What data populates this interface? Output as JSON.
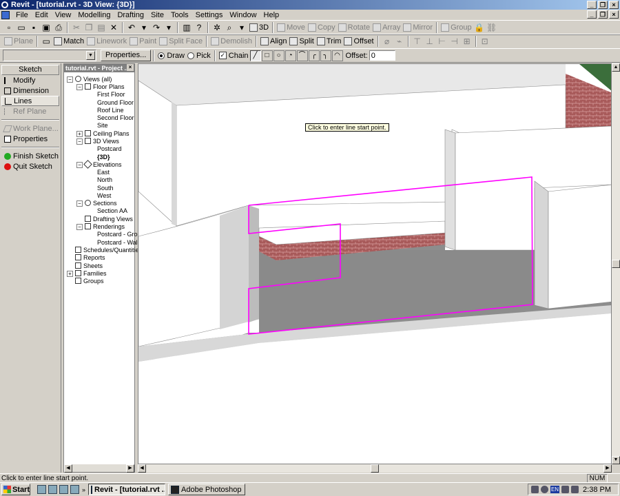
{
  "window": {
    "title": "Revit - [tutorial.rvt - 3D View: {3D}]"
  },
  "menu": [
    "File",
    "Edit",
    "View",
    "Modelling",
    "Drafting",
    "Site",
    "Tools",
    "Settings",
    "Window",
    "Help"
  ],
  "toolbar1": {
    "view3d_label": "3D",
    "move": "Move",
    "copy": "Copy",
    "rotate": "Rotate",
    "array": "Array",
    "mirror": "Mirror",
    "group": "Group"
  },
  "toolbar2": {
    "plane": "Plane",
    "match": "Match",
    "linework": "Linework",
    "paint": "Paint",
    "split_face": "Split Face",
    "demolish": "Demolish",
    "align": "Align",
    "split": "Split",
    "trim": "Trim",
    "offset": "Offset"
  },
  "options": {
    "type_selector_value": "",
    "properties_label": "Properties...",
    "draw_label": "Draw",
    "pick_label": "Pick",
    "chain_label": "Chain",
    "offset_label": "Offset:",
    "offset_value": "0"
  },
  "sketch": {
    "header": "Sketch",
    "items": [
      "Modify",
      "Dimension",
      "Lines",
      "Ref Plane",
      "Work Plane...",
      "Properties",
      "Finish Sketch",
      "Quit Sketch"
    ]
  },
  "browser": {
    "title": "tutorial.rvt - Project ...",
    "nodes": [
      "Views (all)",
      "Floor Plans",
      "First Floor",
      "Ground Floor",
      "Roof Line",
      "Second Floor",
      "Site",
      "Ceiling Plans",
      "3D Views",
      "Postcard",
      "{3D}",
      "Elevations",
      "East",
      "North",
      "South",
      "West",
      "Sections",
      "Section AA",
      "Drafting Views",
      "Renderings",
      "Postcard - Grou",
      "Postcard - Wall",
      "Schedules/Quantitie",
      "Reports",
      "Sheets",
      "Families",
      "Groups"
    ]
  },
  "viewport": {
    "tooltip": "Click to enter line start point."
  },
  "status": {
    "text": "Click to enter line start point.",
    "num": "NUM"
  },
  "taskbar": {
    "start": "Start",
    "task_revit": "Revit - [tutorial.rvt ...",
    "task_photoshop": "Adobe Photoshop",
    "lang": "EN",
    "clock": "2:38 PM"
  }
}
